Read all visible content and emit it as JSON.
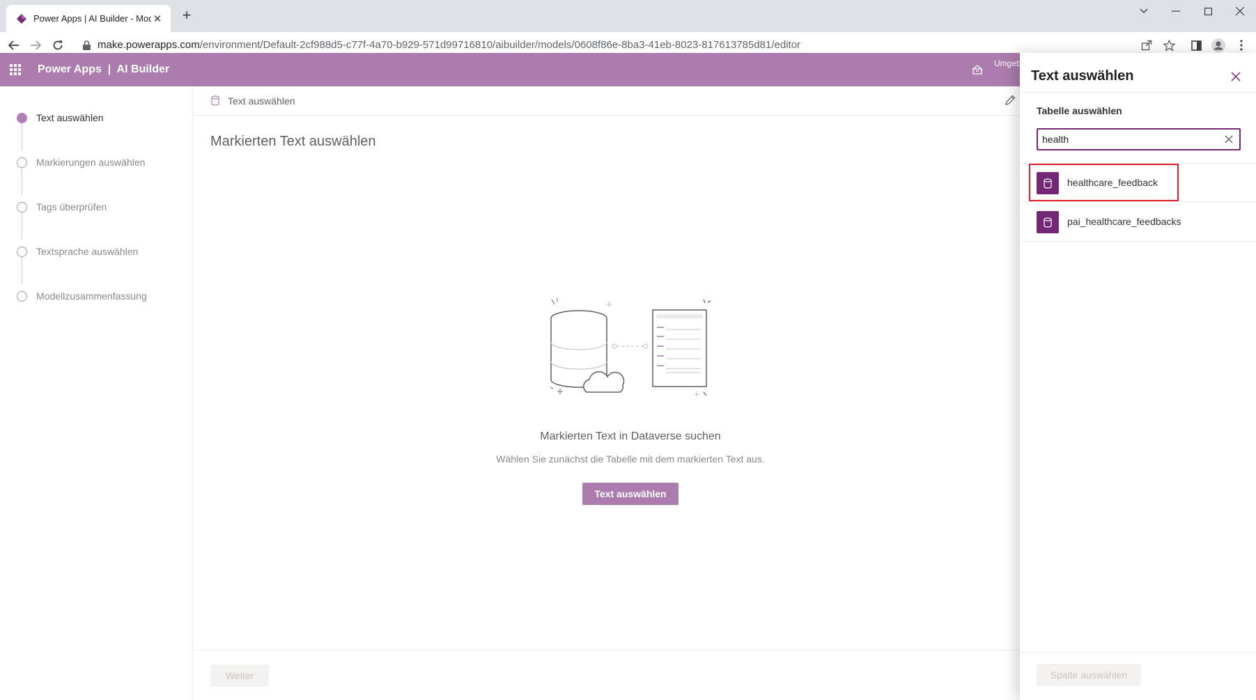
{
  "browser": {
    "tab_title": "Power Apps | AI Builder - Mod",
    "url_host": "make.powerapps.com",
    "url_path": "/environment/Default-2cf988d5-c77f-4a70-b929-571d99716810/aibuilder/models/0608f86e-8ba3-41eb-8023-817613785d81/editor"
  },
  "app": {
    "title": "Power Apps  |  AI Builder",
    "env_label": "Umgeb",
    "accent_color": "#ab7cad"
  },
  "stepper": {
    "steps": [
      {
        "label": "Text auswählen",
        "active": true
      },
      {
        "label": "Markierungen auswählen",
        "active": false
      },
      {
        "label": "Tags überprüfen",
        "active": false
      },
      {
        "label": "Textsprache auswählen",
        "active": false
      },
      {
        "label": "Modellzusammenfassung",
        "active": false
      }
    ]
  },
  "main": {
    "breadcrumb": "Text auswählen",
    "title": "Markierten Text auswählen",
    "empty_title": "Markierten Text in Dataverse suchen",
    "empty_subtitle": "Wählen Sie zunächst die Tabelle mit dem markierten Text aus.",
    "primary_button": "Text auswählen",
    "next_button": "Weiter"
  },
  "panel": {
    "title": "Text auswählen",
    "table_label": "Tabelle auswählen",
    "search_value": "health",
    "results": [
      {
        "label": "healthcare_feedback",
        "highlighted": true
      },
      {
        "label": "pai_healthcare_feedbacks",
        "highlighted": false
      }
    ],
    "column_button": "Spalte auswählen",
    "icon_color": "#742774"
  }
}
